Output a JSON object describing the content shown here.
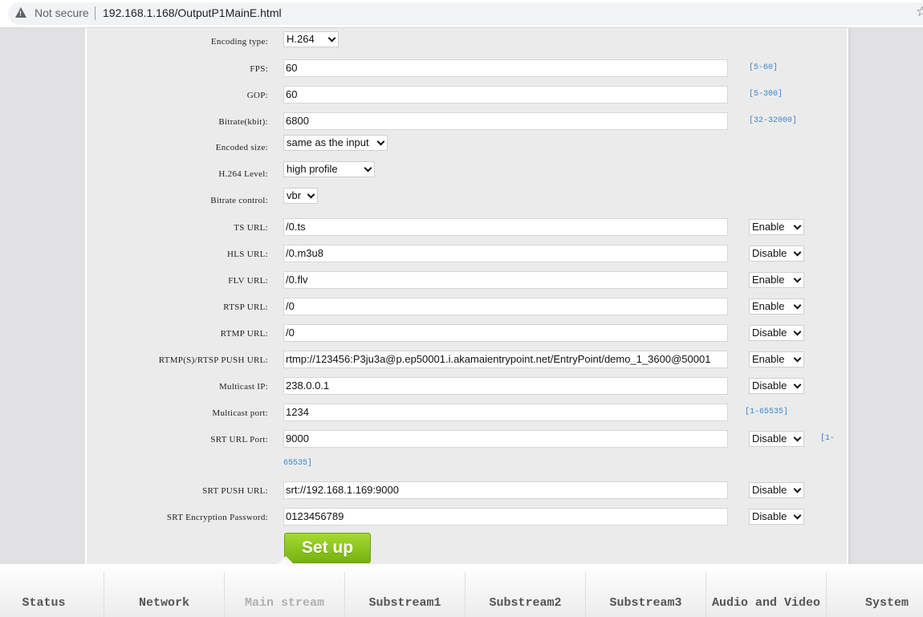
{
  "browser": {
    "security_label": "Not secure",
    "url": "192.168.1.168/OutputP1MainE.html",
    "icons": {
      "security": "warning-triangle-icon",
      "bookmark": "star-icon"
    }
  },
  "form": {
    "encoding_type": {
      "label": "Encoding type:",
      "value": "H.264"
    },
    "fps": {
      "label": "FPS:",
      "value": "60",
      "range": "[5-60]"
    },
    "gop": {
      "label": "GOP:",
      "value": "60",
      "range": "[5-300]"
    },
    "bitrate": {
      "label": "Bitrate(kbit):",
      "value": "6800",
      "range": "[32-32000]"
    },
    "encoded_size": {
      "label": "Encoded size:",
      "value": "same as the input"
    },
    "h264_level": {
      "label": "H.264 Level:",
      "value": "high profile"
    },
    "bitrate_control": {
      "label": "Bitrate control:",
      "value": "vbr"
    },
    "ts_url": {
      "label": "TS URL:",
      "value": "/0.ts",
      "state": "Enable"
    },
    "hls_url": {
      "label": "HLS URL:",
      "value": "/0.m3u8",
      "state": "Disable"
    },
    "flv_url": {
      "label": "FLV URL:",
      "value": "/0.flv",
      "state": "Enable"
    },
    "rtsp_url": {
      "label": "RTSP URL:",
      "value": "/0",
      "state": "Enable"
    },
    "rtmp_url": {
      "label": "RTMP URL:",
      "value": "/0",
      "state": "Disable"
    },
    "push_url": {
      "label": "RTMP(S)/RTSP PUSH URL:",
      "value": "rtmp://123456:P3ju3a@p.ep50001.i.akamaientrypoint.net/EntryPoint/demo_1_3600@50001",
      "state": "Enable"
    },
    "multicast_ip": {
      "label": "Multicast IP:",
      "value": "238.0.0.1",
      "state": "Disable"
    },
    "multicast_port": {
      "label": "Multicast port:",
      "value": "1234",
      "range": "[1-65535]"
    },
    "srt_url_port": {
      "label": "SRT URL Port:",
      "value": "9000",
      "state": "Disable",
      "range_part1": "[1-",
      "range_part2": "65535]"
    },
    "srt_push_url": {
      "label": "SRT PUSH URL:",
      "value": "srt://192.168.1.169:9000",
      "state": "Disable"
    },
    "srt_password": {
      "label": "SRT Encryption Password:",
      "value": "0123456789",
      "state": "Disable"
    },
    "setup_label": "Set up"
  },
  "nav": {
    "active": "Main stream",
    "items": [
      {
        "label": "Status"
      },
      {
        "label": "Network"
      },
      {
        "label": "Main stream"
      },
      {
        "label": "Substream1"
      },
      {
        "label": "Substream2"
      },
      {
        "label": "Substream3"
      },
      {
        "label": "Audio and Video"
      },
      {
        "label": "System"
      }
    ]
  }
}
